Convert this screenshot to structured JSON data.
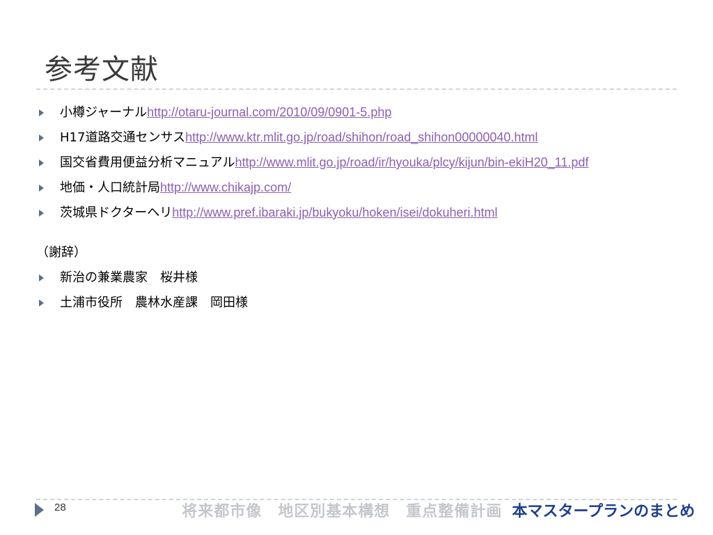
{
  "title": "参考文献",
  "references": [
    {
      "label": "小樽ジャーナル",
      "url": "http://otaru-journal.com/2010/09/0901-5.php"
    },
    {
      "label": "H17道路交通センサス",
      "url": "http://www.ktr.mlit.go.jp/road/shihon/road_shihon00000040.html"
    },
    {
      "label": "国交省費用便益分析マニュアル",
      "url": "http://www.mlit.go.jp/road/ir/hyouka/plcy/kijun/bin-ekiH20_11.pdf"
    },
    {
      "label": "地価・人口統計局",
      "url": "http://www.chikajp.com/"
    },
    {
      "label": "茨城県ドクターヘリ",
      "url": "http://www.pref.ibaraki.jp/bukyoku/hoken/isei/dokuheri.html"
    }
  ],
  "acknowledgements": {
    "heading": "（謝辞）",
    "items": [
      "新治の兼業農家　桜井様",
      "土浦市役所　農林水産課　岡田様"
    ]
  },
  "footer": {
    "page_number": "28",
    "muted_text": "将来都市像　地区別基本構想　重点整備計画",
    "highlight_text": "本マスタープランのまとめ"
  },
  "colors": {
    "bullet": "#5b6f88",
    "link": "#8c5fb0",
    "footer_highlight": "#1f3f8a",
    "footer_muted": "#c4c7cc"
  }
}
